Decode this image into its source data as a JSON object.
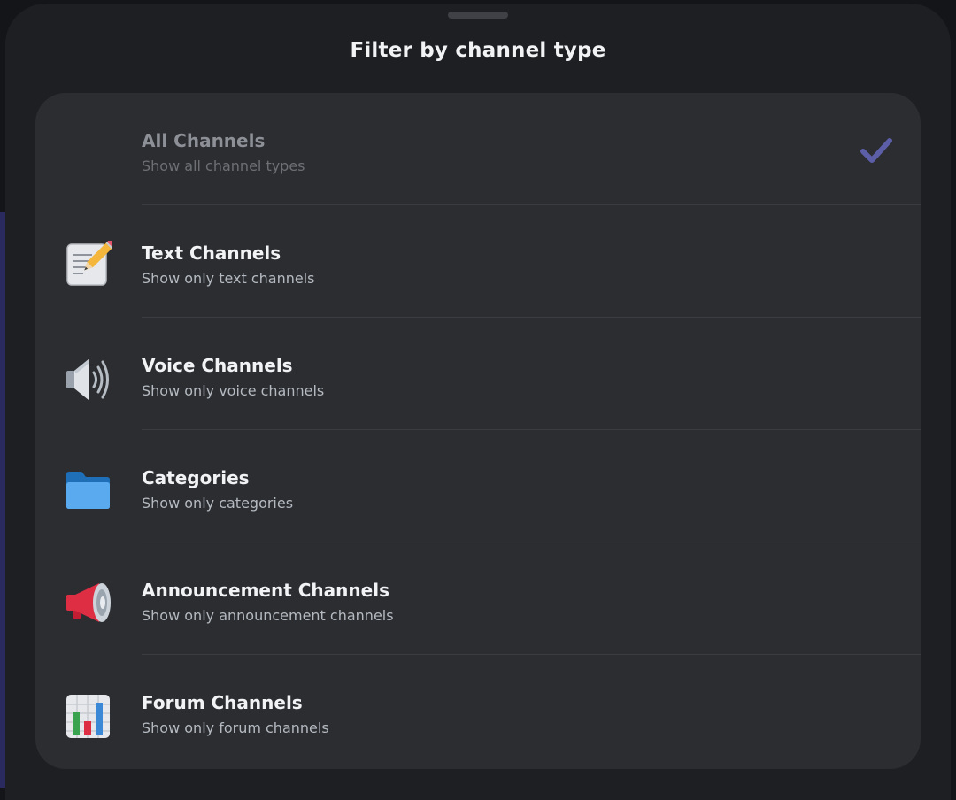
{
  "sheet": {
    "title": "Filter by channel type"
  },
  "options": [
    {
      "title": "All Channels",
      "subtitle": "Show all channel types",
      "icon": "none",
      "selected": true,
      "check_icon": "checkmark-icon"
    },
    {
      "title": "Text Channels",
      "subtitle": "Show only text channels",
      "icon": "memo-pencil-icon",
      "selected": false
    },
    {
      "title": "Voice Channels",
      "subtitle": "Show only voice channels",
      "icon": "speaker-icon",
      "selected": false
    },
    {
      "title": "Categories",
      "subtitle": "Show only categories",
      "icon": "folder-icon",
      "selected": false
    },
    {
      "title": "Announcement Channels",
      "subtitle": "Show only announcement channels",
      "icon": "megaphone-icon",
      "selected": false
    },
    {
      "title": "Forum Channels",
      "subtitle": "Show only forum channels",
      "icon": "bar-chart-icon",
      "selected": false
    }
  ],
  "colors": {
    "sheet_background": "#1e1f22",
    "card_background": "#2b2d31",
    "check_accent": "#5c5fa8"
  }
}
